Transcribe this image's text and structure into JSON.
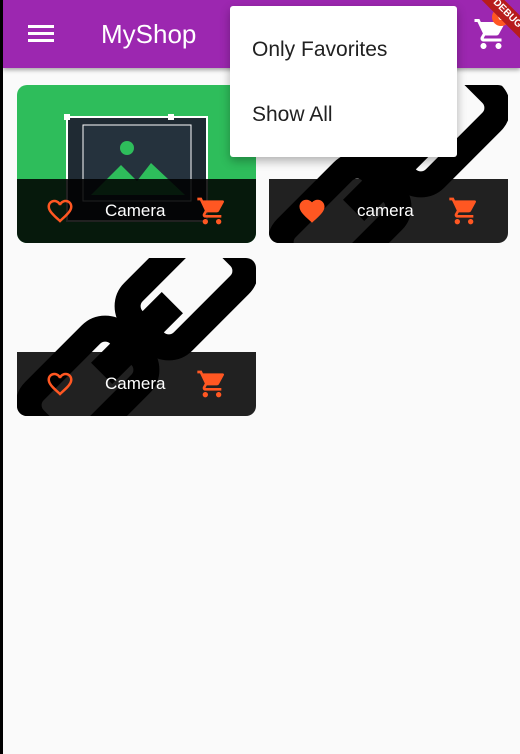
{
  "app": {
    "title": "MyShop",
    "cart_count": "0",
    "banner": "DEBUG"
  },
  "icons": {
    "menu": "menu-icon",
    "cart": "shopping-cart-icon",
    "favorite_outline": "heart-outline-icon",
    "favorite_filled": "heart-filled-icon",
    "image_placeholder": "image-placeholder-icon",
    "broken_link": "broken-link-icon"
  },
  "colors": {
    "appbar": "#9c27b0",
    "accent": "#ff5722",
    "tile_bar": "#000000",
    "background": "#fafafa"
  },
  "products": [
    {
      "name": "Camera",
      "favorite": false,
      "image": "image-placeholder-icon"
    },
    {
      "name": "camera",
      "favorite": true,
      "image": "broken-link-icon"
    },
    {
      "name": "Camera",
      "favorite": false,
      "image": "broken-link-icon"
    }
  ],
  "filter_menu": {
    "items": [
      "Only Favorites",
      "Show All"
    ]
  }
}
